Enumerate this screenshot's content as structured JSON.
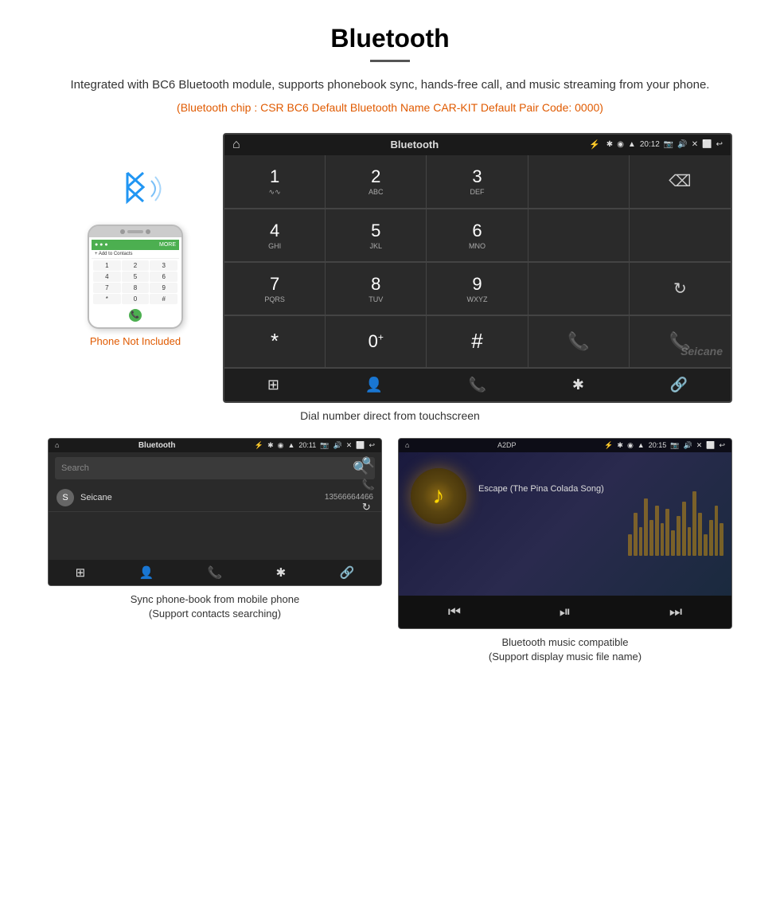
{
  "page": {
    "title": "Bluetooth",
    "divider": true,
    "description": "Integrated with BC6 Bluetooth module, supports phonebook sync, hands-free call, and music streaming from your phone.",
    "specs": "(Bluetooth chip : CSR BC6    Default Bluetooth Name CAR-KIT    Default Pair Code: 0000)",
    "main_caption": "Dial number direct from touchscreen",
    "phone_not_included": "Phone Not Included"
  },
  "car_screen": {
    "status_bar": {
      "home_icon": "⌂",
      "title": "Bluetooth",
      "usb_icon": "⚡",
      "bluetooth_icon": "✱",
      "location_icon": "◉",
      "wifi_icon": "▲",
      "time": "20:12",
      "camera_icon": "📷",
      "volume_icon": "🔊",
      "close_icon": "✕",
      "window_icon": "⬜",
      "back_icon": "↩"
    },
    "dialpad": {
      "keys": [
        {
          "num": "1",
          "sub": "∿∿"
        },
        {
          "num": "2",
          "sub": "ABC"
        },
        {
          "num": "3",
          "sub": "DEF"
        },
        {
          "num": "",
          "sub": ""
        },
        {
          "num": "⌫",
          "sub": ""
        },
        {
          "num": "4",
          "sub": "GHI"
        },
        {
          "num": "5",
          "sub": "JKL"
        },
        {
          "num": "6",
          "sub": "MNO"
        },
        {
          "num": "",
          "sub": ""
        },
        {
          "num": "",
          "sub": ""
        },
        {
          "num": "7",
          "sub": "PQRS"
        },
        {
          "num": "8",
          "sub": "TUV"
        },
        {
          "num": "9",
          "sub": "WXYZ"
        },
        {
          "num": "",
          "sub": ""
        },
        {
          "num": "↻",
          "sub": ""
        },
        {
          "num": "*",
          "sub": ""
        },
        {
          "num": "0",
          "sub": "+"
        },
        {
          "num": "#",
          "sub": ""
        },
        {
          "num": "📞",
          "sub": "green"
        },
        {
          "num": "📞",
          "sub": "red"
        }
      ]
    },
    "bottom_icons": [
      "⊞",
      "👤",
      "📞",
      "✱",
      "🔗"
    ]
  },
  "phonebook_screen": {
    "status": {
      "home": "⌂",
      "title": "Bluetooth",
      "usb": "⚡",
      "time": "20:11"
    },
    "search_placeholder": "Search",
    "contacts": [
      {
        "initial": "S",
        "name": "Seicane",
        "number": "13566664466"
      }
    ],
    "bottom_icons": [
      "⊞",
      "👤",
      "📞",
      "✱",
      "🔗"
    ]
  },
  "music_screen": {
    "status": {
      "home": "⌂",
      "title": "A2DP",
      "time": "20:15"
    },
    "song_title": "Escape (The Pina Colada Song)",
    "album_icon": "♪",
    "controls": [
      "⏮",
      "⏯",
      "⏭"
    ]
  },
  "captions": {
    "phonebook": "Sync phone-book from mobile phone\n(Support contacts searching)",
    "music": "Bluetooth music compatible\n(Support display music file name)"
  },
  "phone_mockup": {
    "keys": [
      "1",
      "2",
      "3",
      "4",
      "5",
      "6",
      "7",
      "8",
      "9",
      "*",
      "0",
      "#"
    ]
  }
}
